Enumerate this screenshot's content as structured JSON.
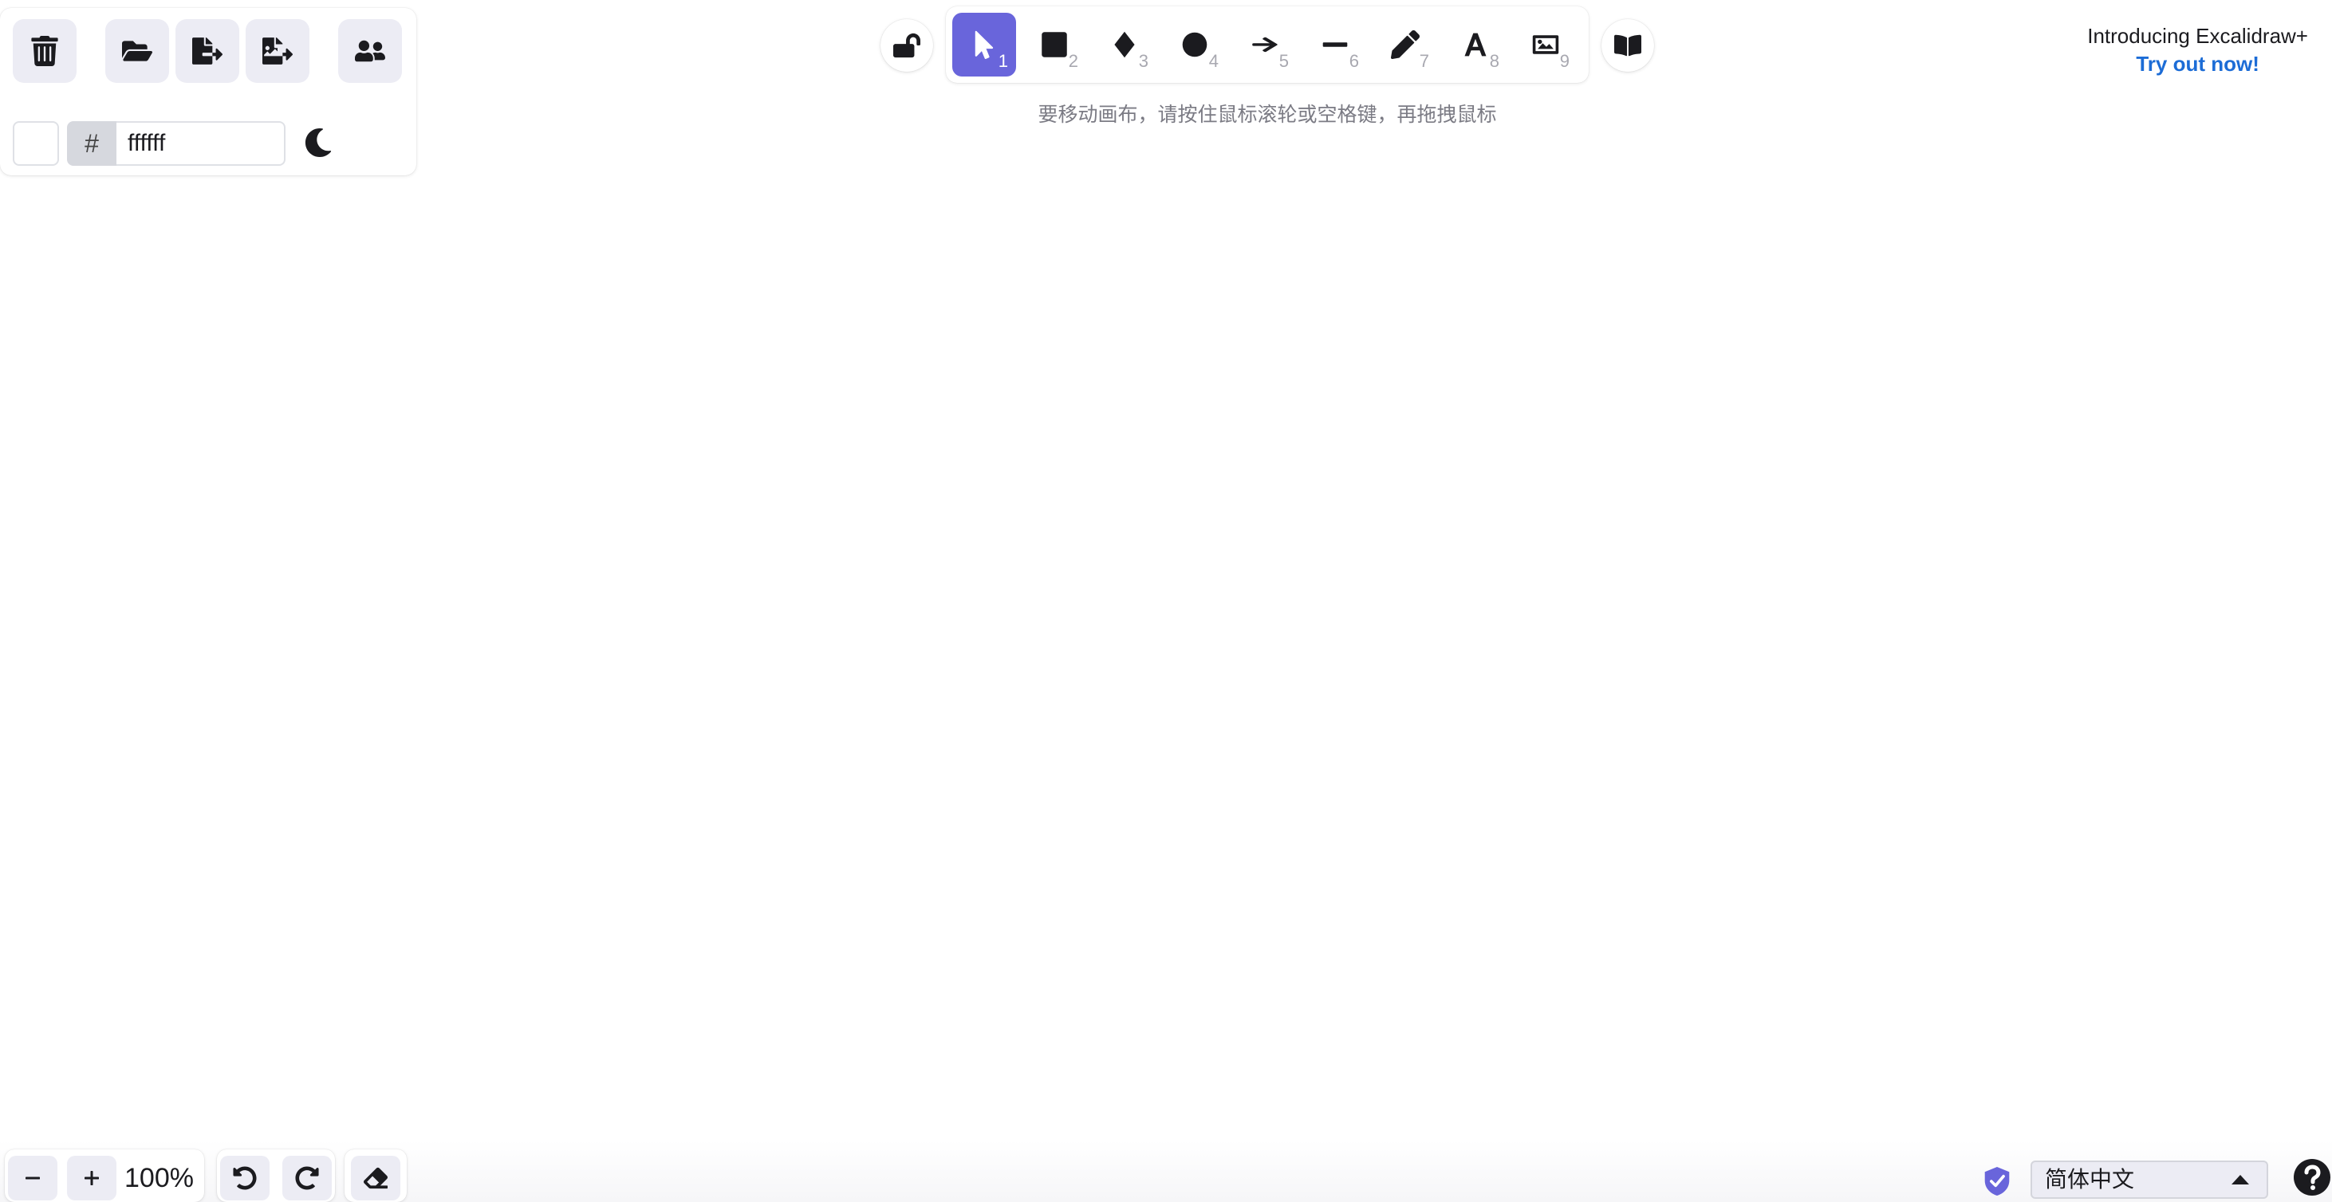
{
  "menu": {
    "clear_canvas_icon": "trash-icon",
    "open_icon": "folder-open-icon",
    "save_icon": "file-export-icon",
    "export_image_icon": "image-export-icon",
    "collab_icon": "users-icon"
  },
  "background": {
    "hash": "#",
    "value": "ffffff",
    "swatch_color": "#ffffff",
    "theme_icon": "moon-icon"
  },
  "toolbar": {
    "lock_icon": "unlock-icon",
    "library_icon": "book-icon",
    "accent_color": "#6965db",
    "tools": [
      {
        "icon": "pointer-icon",
        "key": "1"
      },
      {
        "icon": "rectangle-icon",
        "key": "2"
      },
      {
        "icon": "diamond-icon",
        "key": "3"
      },
      {
        "icon": "ellipse-icon",
        "key": "4"
      },
      {
        "icon": "arrow-icon",
        "key": "5"
      },
      {
        "icon": "line-icon",
        "key": "6"
      },
      {
        "icon": "pencil-icon",
        "key": "7"
      },
      {
        "icon": "text-icon",
        "key": "8"
      },
      {
        "icon": "image-icon",
        "key": "9"
      }
    ]
  },
  "hint": "要移动画布，请按住鼠标滚轮或空格键，再拖拽鼠标",
  "promo": {
    "title": "Introducing Excalidraw+",
    "link": "Try out now!"
  },
  "footer": {
    "zoom_out": "−",
    "zoom_in": "+",
    "zoom_level": "100%",
    "language": "简体中文"
  }
}
